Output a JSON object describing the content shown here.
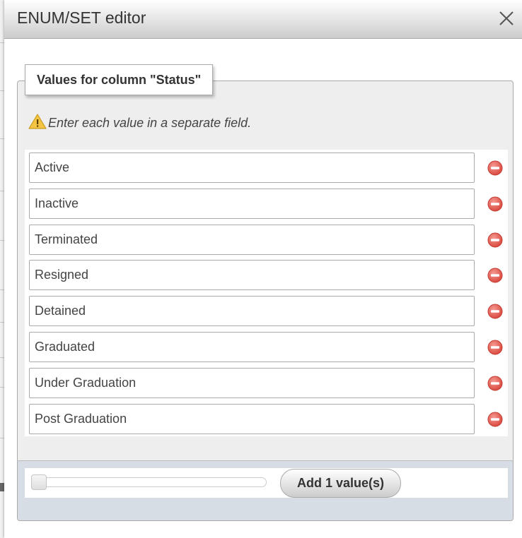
{
  "dialog": {
    "title": "ENUM/SET editor",
    "close_icon": "close-icon"
  },
  "fieldset": {
    "legend": "Values for column \"Status\"",
    "notice_icon": "warning-icon",
    "notice": "Enter each value in a separate field."
  },
  "values": [
    {
      "value": "Active",
      "drop_icon": "remove-icon"
    },
    {
      "value": "Inactive",
      "drop_icon": "remove-icon"
    },
    {
      "value": "Terminated",
      "drop_icon": "remove-icon"
    },
    {
      "value": "Resigned",
      "drop_icon": "remove-icon"
    },
    {
      "value": "Detained",
      "drop_icon": "remove-icon"
    },
    {
      "value": "Graduated",
      "drop_icon": "remove-icon"
    },
    {
      "value": "Under Graduation",
      "drop_icon": "remove-icon"
    },
    {
      "value": "Post Graduation",
      "drop_icon": "remove-icon"
    }
  ],
  "add_values": {
    "slider_value": 1,
    "button_label": "Add 1 value(s)"
  },
  "colors": {
    "remove_icon": "#e0574e",
    "warning_icon": "#f4c542"
  }
}
